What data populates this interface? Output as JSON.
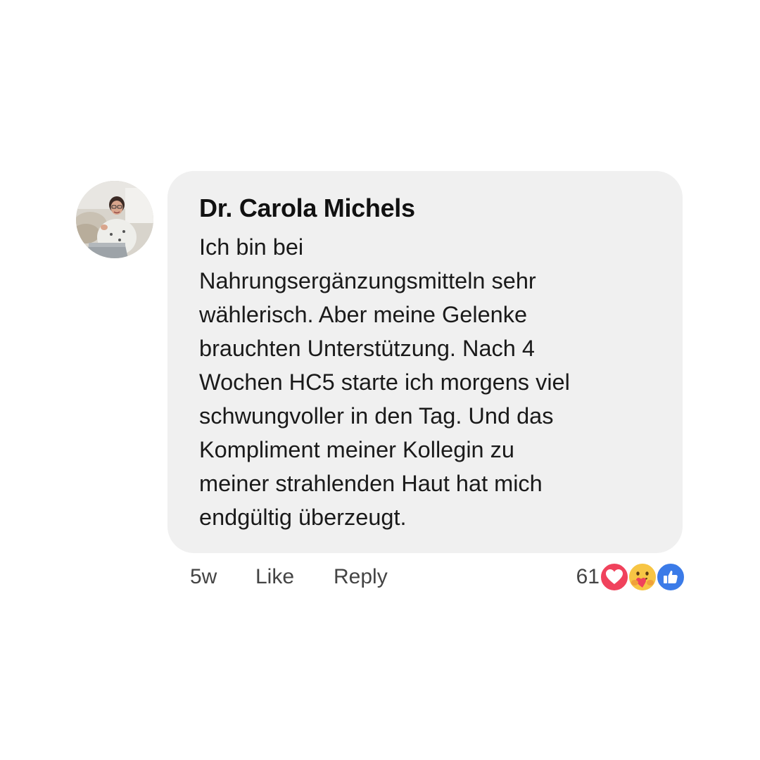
{
  "comment": {
    "author": "Dr. Carola Michels",
    "text": "Ich bin bei\nNahrungsergänzungsmitteln sehr\nwählerisch. Aber meine Gelenke\nbrauchten Unterstützung. Nach 4\nWochen HC5 starte ich morgens viel\nschwungvoller in den Tag. Und das\nKompliment meiner Kollegin zu\nmeiner strahlenden Haut hat mich\nendgültig überzeugt.",
    "time": "5w",
    "like_label": "Like",
    "reply_label": "Reply",
    "reactions": {
      "count": "61",
      "icons": [
        "love-reaction-icon",
        "care-reaction-icon",
        "like-reaction-icon"
      ]
    }
  },
  "colors": {
    "bubble": "#f0f0f0",
    "love": "#f0425c",
    "care": "#f7c544",
    "like": "#3b7be8"
  }
}
